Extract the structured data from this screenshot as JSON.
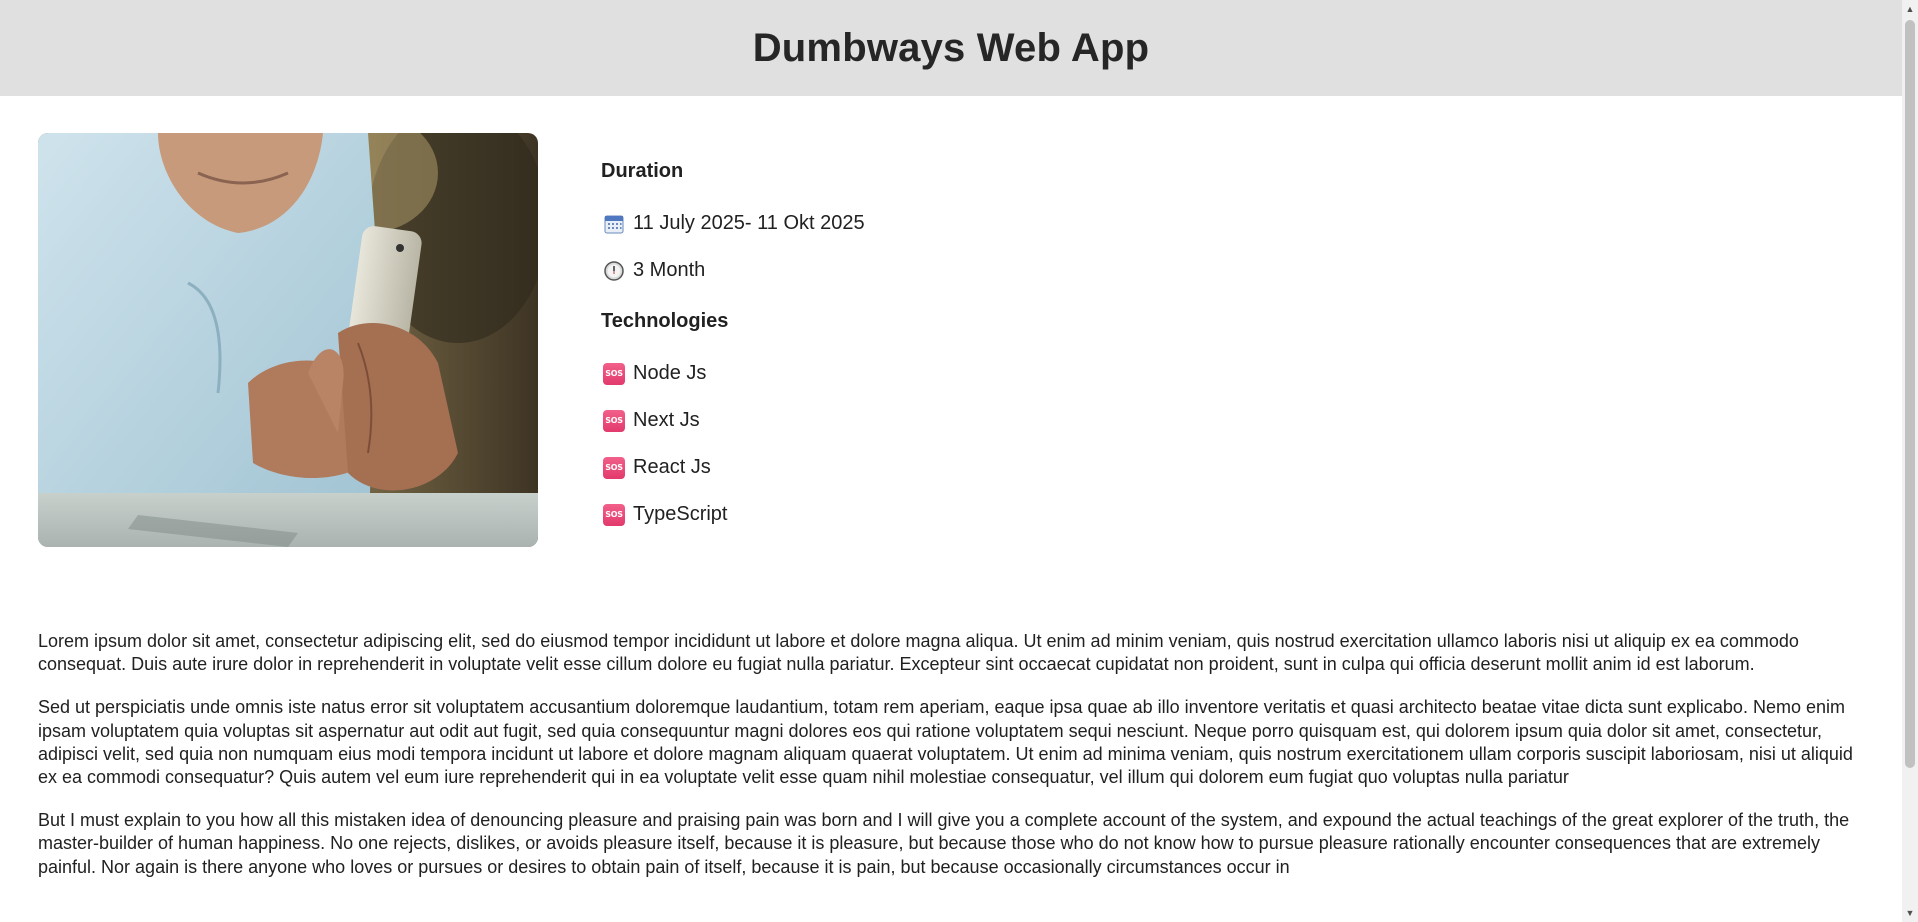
{
  "header": {
    "title": "Dumbways Web App"
  },
  "duration": {
    "heading": "Duration",
    "date_range": "11 July 2025- 11 Okt 2025",
    "length": "3 Month"
  },
  "technologies": {
    "heading": "Technologies",
    "icon_text": "SOS",
    "items": [
      "Node Js",
      "Next Js",
      "React Js",
      "TypeScript"
    ]
  },
  "content": {
    "paragraphs": [
      "Lorem ipsum dolor sit amet, consectetur adipiscing elit, sed do eiusmod tempor incididunt ut labore et dolore magna aliqua. Ut enim ad minim veniam, quis nostrud exercitation ullamco laboris nisi ut aliquip ex ea commodo consequat. Duis aute irure dolor in reprehenderit in voluptate velit esse cillum dolore eu fugiat nulla pariatur. Excepteur sint occaecat cupidatat non proident, sunt in culpa qui officia deserunt mollit anim id est laborum.",
      "Sed ut perspiciatis unde omnis iste natus error sit voluptatem accusantium doloremque laudantium, totam rem aperiam, eaque ipsa quae ab illo inventore veritatis et quasi architecto beatae vitae dicta sunt explicabo. Nemo enim ipsam voluptatem quia voluptas sit aspernatur aut odit aut fugit, sed quia consequuntur magni dolores eos qui ratione voluptatem sequi nesciunt. Neque porro quisquam est, qui dolorem ipsum quia dolor sit amet, consectetur, adipisci velit, sed quia non numquam eius modi tempora incidunt ut labore et dolore magnam aliquam quaerat voluptatem. Ut enim ad minima veniam, quis nostrum exercitationem ullam corporis suscipit laboriosam, nisi ut aliquid ex ea commodi consequatur? Quis autem vel eum iure reprehenderit qui in ea voluptate velit esse quam nihil molestiae consequatur, vel illum qui dolorem eum fugiat quo voluptas nulla pariatur",
      "But I must explain to you how all this mistaken idea of denouncing pleasure and praising pain was born and I will give you a complete account of the system, and expound the actual teachings of the great explorer of the truth, the master-builder of human happiness. No one rejects, dislikes, or avoids pleasure itself, because it is pleasure, but because those who do not know how to pursue pleasure rationally encounter consequences that are extremely painful. Nor again is there anyone who loves or pursues or desires to obtain pain of itself, because it is pain, but because occasionally circumstances occur in"
    ]
  },
  "colors": {
    "header_bg": "#e0e0e0",
    "tech_icon": "#e23a6c"
  }
}
